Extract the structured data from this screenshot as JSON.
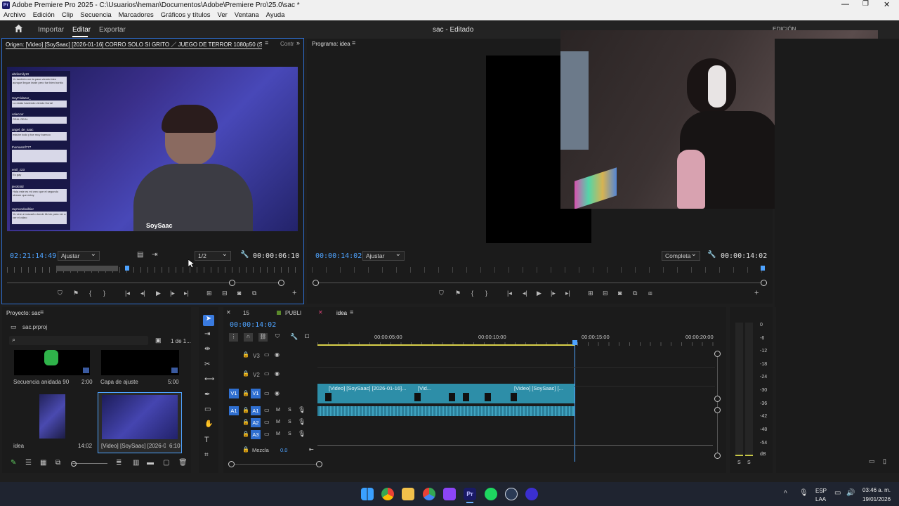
{
  "window": {
    "title": "Adobe Premiere Pro 2025 - C:\\Usuarios\\heman\\Documentos\\Adobe\\Premiere Pro\\25.0\\sac *",
    "menu": [
      "Archivo",
      "Edición",
      "Clip",
      "Secuencia",
      "Marcadores",
      "Gráficos y títulos",
      "Ver",
      "Ventana",
      "Ayuda"
    ]
  },
  "workspace": {
    "tabs": [
      "Importar",
      "Editar",
      "Exportar"
    ],
    "active_tab": "Editar",
    "project_title": "sac - Editado",
    "mode": "EDICIÓN"
  },
  "source_monitor": {
    "tab_label": "Origen: [Video] [SoySaac] [2026-01-16] CORRO SOLO SI GRITO ／ JUEGO DE TERROR 1080p50 (Source).mp4",
    "extra_tab": "Contr",
    "timecode": "02:21:14:49",
    "fit": "Ajustar",
    "resolution": "1/2",
    "duration": "00:00:06:10",
    "video_watermark": "SoySaac",
    "chat": [
      {
        "user": "abrilemily10",
        "msg": "Yo también me la pase viendo bien aunque llegue tarde pero fue bien bonito"
      },
      {
        "user": "SoyFridazar_",
        "msg": "Lo estás haciendo viendo Korra!"
      },
      {
        "user": "valeccvr",
        "msg": "REAL REAL"
      },
      {
        "user": "angel_de_saac",
        "msg": "estube todo y fue muy buenoo"
      },
      {
        "user": "thomasmf777",
        "msg": ""
      },
      {
        "user": "emil_z23",
        "msg": "Es gay"
      },
      {
        "user": "jerolckid",
        "msg": "Hola este es mi creo que el segundo stream que estoy"
      },
      {
        "user": "raymondoulbier",
        "msg": "Yo vine a buscarlo donde tik tok para ver a ver el video"
      }
    ]
  },
  "program_monitor": {
    "tab_label": "Programa: idea",
    "timecode": "00:00:14:02",
    "fit": "Ajustar",
    "quality": "Completa",
    "duration": "00:00:14:02"
  },
  "project_panel": {
    "tab_label": "Proyecto: sac",
    "file": "sac.prproj",
    "count": "1 de 1...",
    "items": [
      {
        "name": "Secuencia anidada 90",
        "duration": "2:00"
      },
      {
        "name": "Capa de ajuste",
        "duration": "5:00"
      },
      {
        "name": "idea",
        "duration": "14:02"
      },
      {
        "name": "[Video] [SoySaac] [2026-01...",
        "duration": "6:10"
      }
    ]
  },
  "timeline": {
    "tabs": [
      "15",
      "PUBLI",
      "idea"
    ],
    "active_tab": "idea",
    "timecode": "00:00:14:02",
    "ruler": [
      "00:00:05:00",
      "00:00:10:00",
      "00:00:15:00",
      "00:00:20:00"
    ],
    "video_tracks": [
      "V3",
      "V2",
      "V1"
    ],
    "audio_tracks": [
      "A1",
      "A2",
      "A3"
    ],
    "source_patch_video": "V1",
    "source_patch_audio": "A1",
    "mix_label": "Mezcla",
    "mix_value": "0.0",
    "clips": [
      "[Video] [SoySaac] [2026-01-16]...",
      "[Vid...",
      "[Video] [SoySaac] [..."
    ],
    "mute_label": "M",
    "solo_label": "S"
  },
  "audio_meter": {
    "scale": [
      "0",
      "-6",
      "-12",
      "-18",
      "-24",
      "-30",
      "-36",
      "-42",
      "-48",
      "-54",
      "dB"
    ],
    "channels": [
      "S",
      "S"
    ]
  },
  "taskbar": {
    "lang": "ESP",
    "region": "LAA",
    "time": "03:46 a. m.",
    "date": "19/01/2026"
  },
  "colors": {
    "accent": "#2f6fd0",
    "timecode_blue": "#4ea3ff",
    "clip": "#2d8ea8",
    "playhead": "#4ea3ff",
    "work_area": "#d8d04a"
  }
}
